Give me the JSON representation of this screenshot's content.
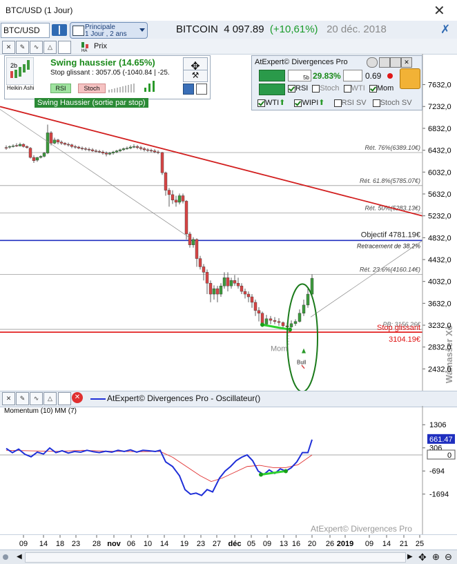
{
  "window": {
    "title": "BTC/USD (1 Jour)",
    "close_glyph": "✕"
  },
  "toolbar": {
    "symbol": "BTC/USD",
    "layout_line1": "Principale",
    "layout_line2": "1 Jour , 2 ans",
    "instrument": "BITCOIN",
    "price": "4 097.89",
    "change": "(+10,61%)",
    "date": "20 déc. 2018"
  },
  "toolbar2": {
    "price_mode_label": "Prix",
    "icon_badge": "HA"
  },
  "signal_panel": {
    "mini_label": "2b",
    "chart_type": "Heikin Ashi",
    "headline": "Swing haussier (14.65%)",
    "stop_text": "Stop glissant : 3057.05  (-1040.84 | -25.",
    "rsi": "RSI",
    "stoch": "Stoch",
    "badge": "Swing Haussier (sortie par stop)"
  },
  "divergence_panel": {
    "title": "AtExpert© Divergences Pro",
    "pct": "29.83%",
    "ratio": "0.69",
    "sub_5b": "5b",
    "checks_row1": [
      {
        "label": "RSI",
        "checked": true
      },
      {
        "label": "Stoch",
        "checked": false
      },
      {
        "label": "WTI",
        "checked": false
      },
      {
        "label": "Mom",
        "checked": true
      }
    ],
    "checks_row2": [
      {
        "label": "WTI",
        "checked": true
      },
      {
        "label": "WIPI",
        "checked": true
      },
      {
        "label": "RSI SV",
        "checked": false
      },
      {
        "label": "Stoch SV",
        "checked": false
      }
    ]
  },
  "price_axis": [
    "7632,0",
    "7232,0",
    "6832,0",
    "6432,0",
    "6032,0",
    "5632,0",
    "5232,0",
    "4832,0",
    "4432,0",
    "4032,0",
    "3632,0",
    "3232,0",
    "2832,0",
    "2432,0"
  ],
  "levels": {
    "fib76": "Rét. 76%(6389.10€)",
    "fib618": "Rét. 61.8%(5785.07€)",
    "fib50": "Rét. 50%(5283.13€)",
    "objectif": "Objectif  4781.19€",
    "retracement": "Retracement de 38.2%",
    "fib236": "Rét. 23.6%(4160.14€)",
    "pb": "PB: 3156.26€",
    "stop": "Stop glissant",
    "stop_value": "3104.19€",
    "mom": "Mom",
    "bull": "Bull",
    "watermark": "Wamasser Xe"
  },
  "oscillator": {
    "bar_title": "AtExpert© Divergences Pro - Oscillateur()",
    "label": "Momentum (10) MM (7)",
    "axis": [
      "1306",
      "306",
      "-694",
      "-1694"
    ],
    "current": "661.47",
    "zero": "0",
    "credit": "AtExpert© Divergences Pro"
  },
  "time_axis": [
    "09",
    "14",
    "18",
    "23",
    "28",
    "nov",
    "06",
    "10",
    "14",
    "19",
    "23",
    "27",
    "déc",
    "05",
    "09",
    "13",
    "16",
    "20",
    "26",
    "2019",
    "09",
    "14",
    "21",
    "25"
  ],
  "colors": {
    "up": "#3d9a3d",
    "down": "#d64545",
    "trend": "#d21f1f",
    "objectif": "#1f2fbf",
    "stop": "#e01010",
    "momentum": "#1f2fd8",
    "signal": "#e03030",
    "green": "#2ed12e"
  }
}
